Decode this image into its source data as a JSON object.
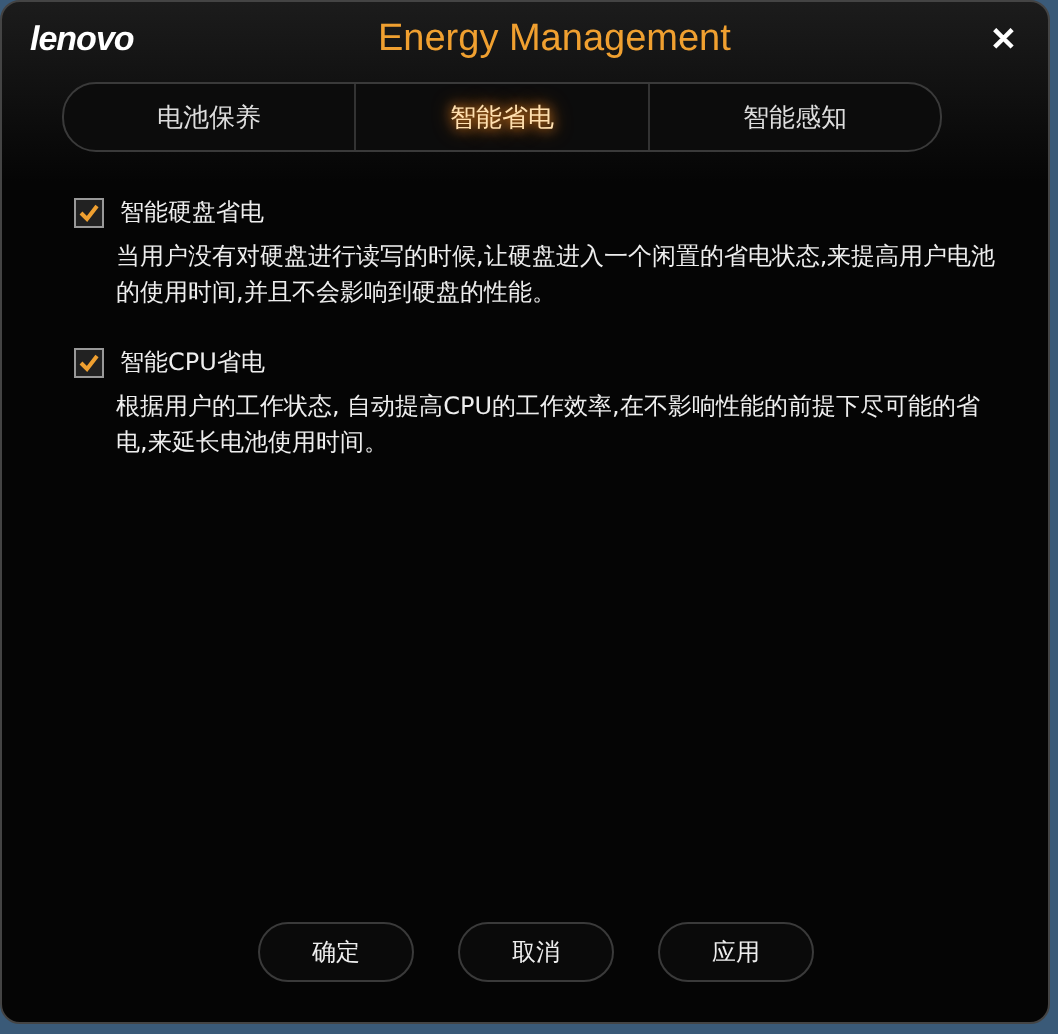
{
  "window": {
    "logo": "lenovo",
    "title": "Energy Management",
    "close": "✕"
  },
  "tabs": [
    {
      "label": "电池保养",
      "selected": false
    },
    {
      "label": "智能省电",
      "selected": true
    },
    {
      "label": "智能感知",
      "selected": false
    }
  ],
  "options": [
    {
      "label": "智能硬盘省电",
      "checked": true,
      "description": "当用户没有对硬盘进行读写的时候,让硬盘进入一个闲置的省电状态,来提高用户电池的使用时间,并且不会影响到硬盘的性能。"
    },
    {
      "label": "智能CPU省电",
      "checked": true,
      "description": "根据用户的工作状态, 自动提高CPU的工作效率,在不影响性能的前提下尽可能的省电,来延长电池使用时间。"
    }
  ],
  "buttons": [
    "确定",
    "取消",
    "应用"
  ]
}
